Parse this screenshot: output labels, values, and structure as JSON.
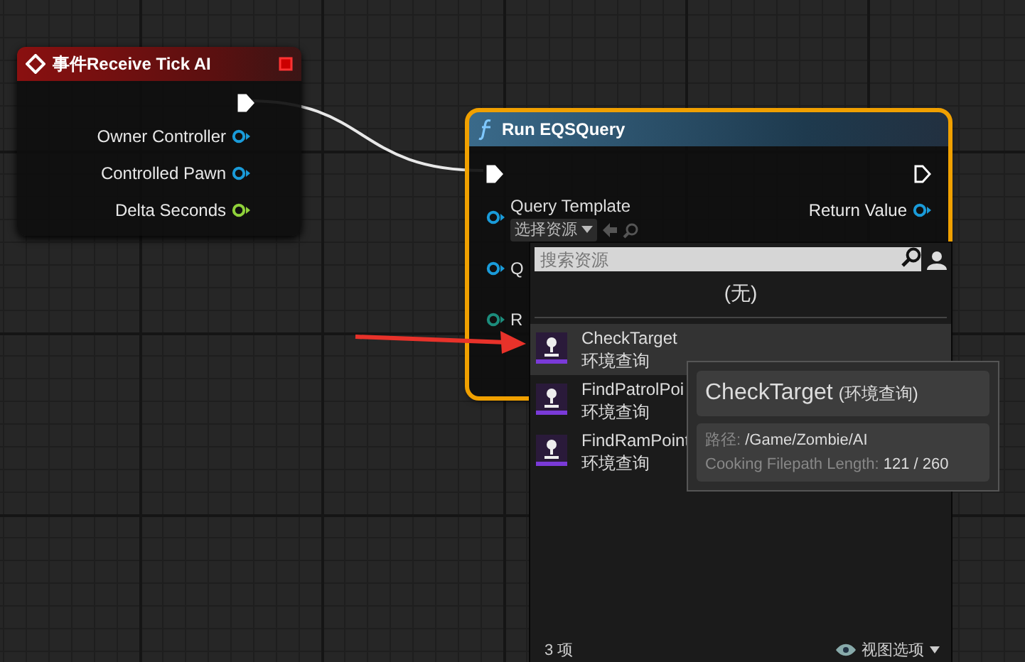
{
  "nodes": [
    {
      "kind": "event",
      "selected": false,
      "title": "事件Receive Tick AI",
      "exec_out": {
        "connected": true
      },
      "outputs": [
        {
          "label": "Owner Controller",
          "color": "#1a9bd9"
        },
        {
          "label": "Controlled Pawn",
          "color": "#1a9bd9"
        },
        {
          "label": "Delta Seconds",
          "color": "#8fd13a"
        }
      ]
    },
    {
      "kind": "function",
      "selected": true,
      "title": "Run EQSQuery",
      "exec_in": {
        "connected": true
      },
      "exec_out": {
        "connected": false
      },
      "inputs": [
        {
          "label": "Query Template",
          "color": "#1a9bd9",
          "dropdown": "选择资源"
        },
        {
          "label": "Q",
          "color": "#1a9bd9"
        },
        {
          "label": "R",
          "color": "#1c8c7c"
        }
      ],
      "outputs": [
        {
          "label": "Return Value",
          "color": "#1a9bd9"
        }
      ]
    }
  ],
  "asset_picker": {
    "search": {
      "placeholder": "搜索资源"
    },
    "none_option": "(无)",
    "items": [
      {
        "name": "CheckTarget",
        "type": "环境查询",
        "selected": true
      },
      {
        "name": "FindPatrolPoi",
        "type": "环境查询",
        "selected": false
      },
      {
        "name": "FindRamPoint",
        "type": "环境查询",
        "selected": false
      }
    ],
    "count": "3 项",
    "view_options": "视图选项"
  },
  "tooltip": {
    "name": "CheckTarget",
    "type": "(环境查询)",
    "rows": [
      {
        "label": "路径: ",
        "value": "/Game/Zombie/AI"
      },
      {
        "label": "Cooking Filepath Length: ",
        "value": "121 / 260"
      }
    ]
  }
}
